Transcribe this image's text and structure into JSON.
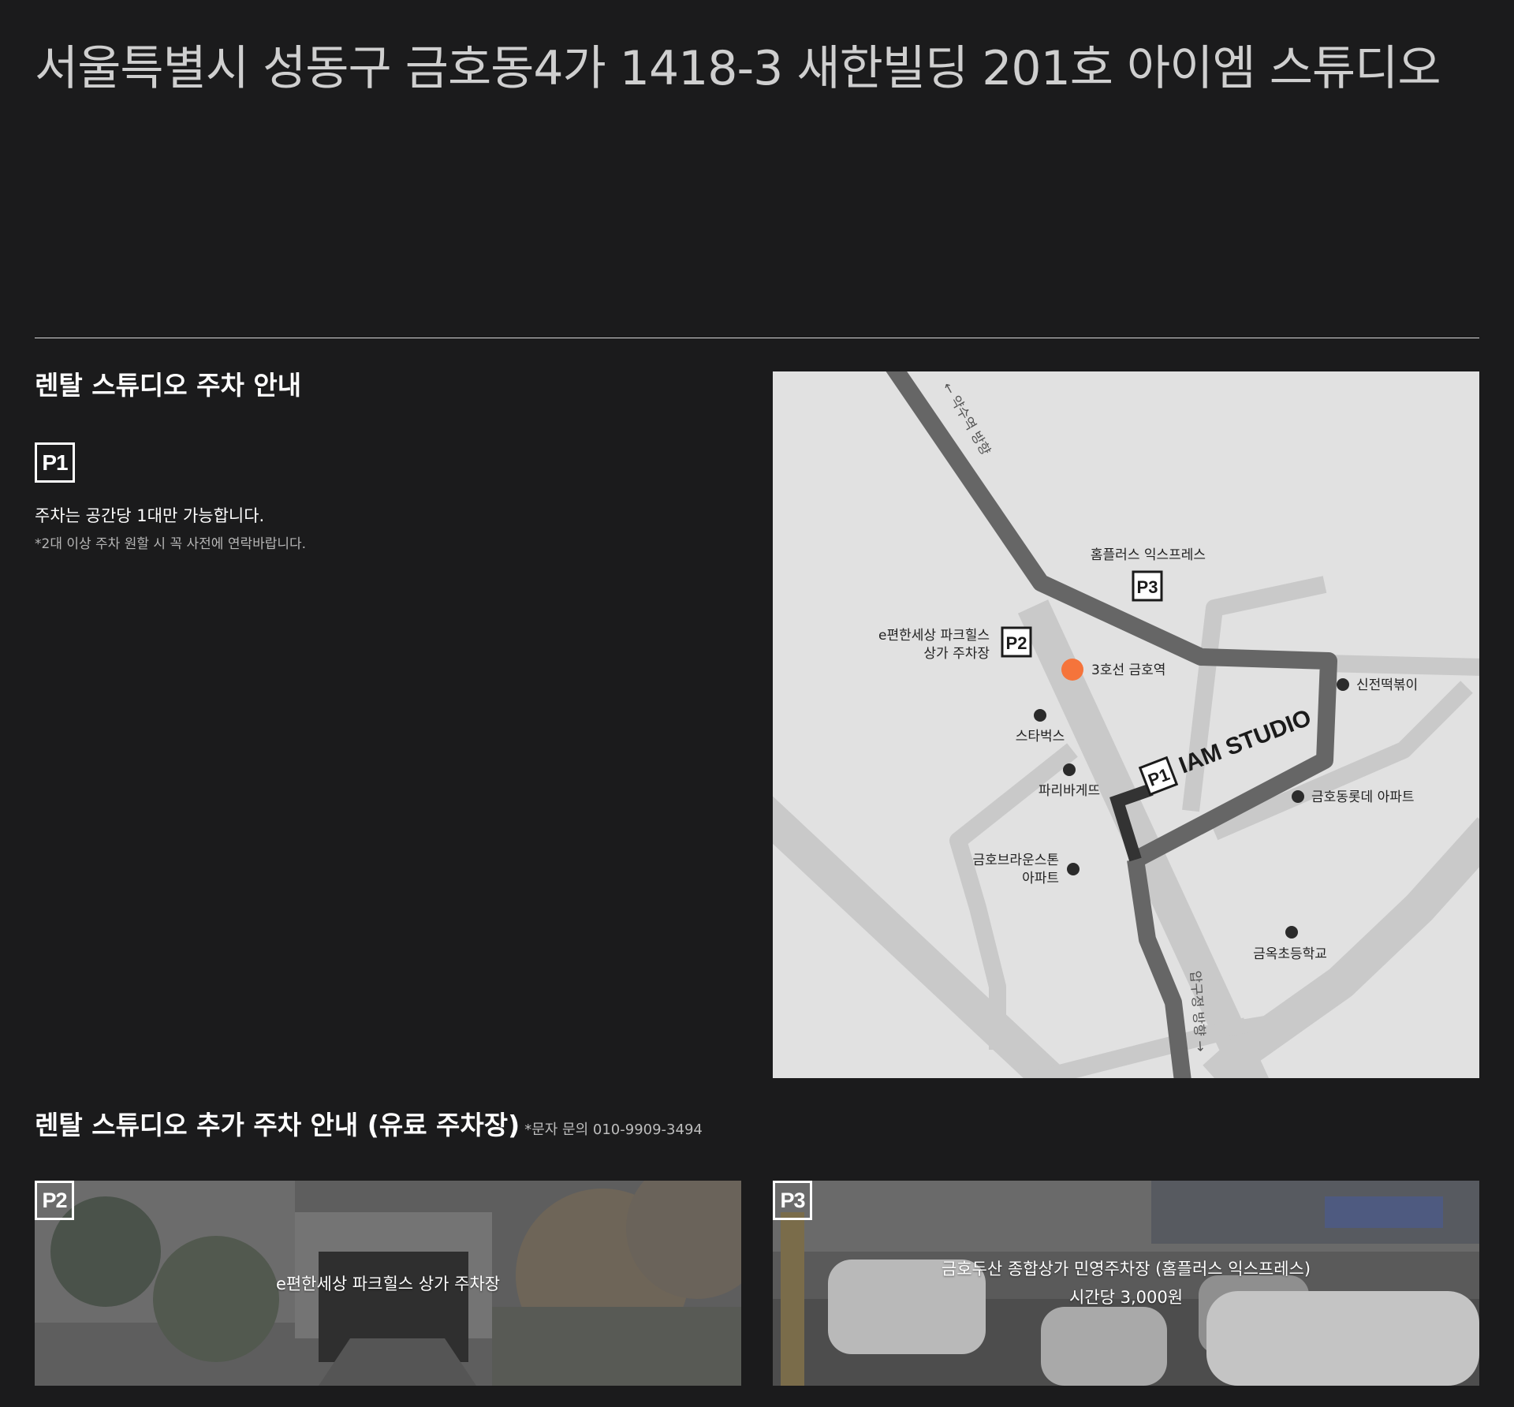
{
  "address": "서울특별시 성동구 금호동4가 1418-3 새한빌딩 201호 아이엠 스튜디오",
  "parking": {
    "title": "렌탈 스튜디오 주차 안내",
    "badge": "P1",
    "text": "주차는 공간당 1대만 가능합니다.",
    "note": "*2대 이상 주차 원할 시 꼭 사전에 연락바랍니다."
  },
  "map": {
    "direction_top": "← 약수역 방향",
    "direction_bottom": "압구정 방향 →",
    "station": "3호선 금호역",
    "studio_name": "IAM STUDIO",
    "badges": {
      "p1": "P1",
      "p2": "P2",
      "p3": "P3"
    },
    "p2_label_line1": "e편한세상 파크힐스",
    "p2_label_line2": "상가 주차장",
    "p3_label": "홈플러스 익스프레스",
    "landmarks": {
      "starbucks": "스타벅스",
      "paris": "파리바게뜨",
      "brownstone_line1": "금호브라운스톤",
      "brownstone_line2": "아파트",
      "sinjeon": "신전떡볶이",
      "lotte": "금호동롯데 아파트",
      "school": "금옥초등학교"
    },
    "colors": {
      "background": "#e1e1e1",
      "road_light": "#c9c9c9",
      "road_dark": "#666666",
      "route": "#333333",
      "station": "#f5743b"
    }
  },
  "extra_parking": {
    "title": "렌탈 스튜디오 추가 주차 안내 (유료 주차장)",
    "note": "*문자 문의 010-9909-3494",
    "cards": [
      {
        "badge": "P2",
        "line1": "e편한세상 파크힐스 상가 주차장",
        "line2": ""
      },
      {
        "badge": "P3",
        "line1": "금호두산 종합상가 민영주차장 (홈플러스 익스프레스)",
        "line2": "시간당 3,000원"
      }
    ]
  }
}
